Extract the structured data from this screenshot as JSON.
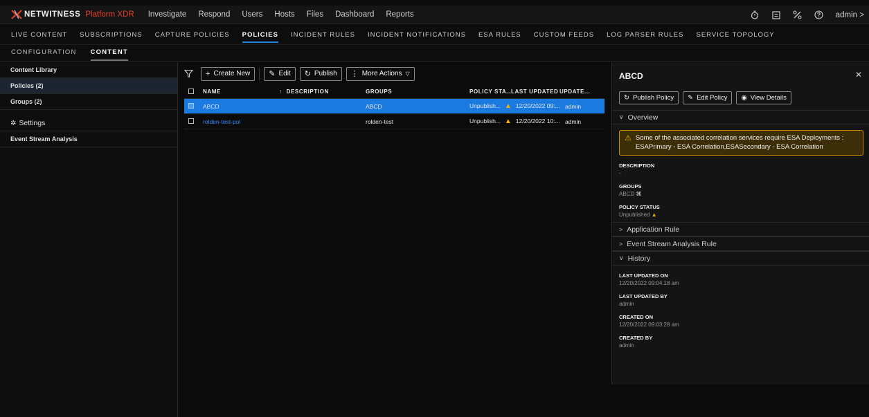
{
  "app": {
    "logo_text": "NETWITNESS",
    "logo_sub": "Platform XDR",
    "nav": [
      "Investigate",
      "Respond",
      "Users",
      "Hosts",
      "Files",
      "Dashboard",
      "Reports"
    ],
    "user": "admin"
  },
  "subnav": [
    "LIVE CONTENT",
    "SUBSCRIPTIONS",
    "CAPTURE POLICIES",
    "POLICIES",
    "INCIDENT RULES",
    "INCIDENT NOTIFICATIONS",
    "ESA RULES",
    "CUSTOM FEEDS",
    "LOG PARSER RULES",
    "SERVICE TOPOLOGY"
  ],
  "subnav_active": "POLICIES",
  "tabs": [
    "CONFIGURATION",
    "CONTENT"
  ],
  "tab_active": "CONTENT",
  "sidebar": {
    "items": [
      "Content Library",
      "Policies (2)",
      "Groups (2)"
    ],
    "selected": "Policies (2)",
    "settings_label": "Settings",
    "settings_items": [
      "Event Stream Analysis"
    ]
  },
  "toolbar": {
    "create_label": "Create New",
    "edit_label": "Edit",
    "publish_label": "Publish",
    "more_label": "More Actions"
  },
  "table": {
    "columns": [
      "NAME",
      "DESCRIPTION",
      "GROUPS",
      "POLICY STA...",
      "LAST UPDATED",
      "UPDATE..."
    ],
    "rows": [
      {
        "name": "ABCD",
        "description": "",
        "groups": "ABCD",
        "status": "Unpublish...",
        "last_updated": "12/20/2022 09:...",
        "updated_by": "admin"
      },
      {
        "name": "rolden-test-pol",
        "description": "",
        "groups": "rolden-test",
        "status": "Unpublish...",
        "last_updated": "12/20/2022 10:...",
        "updated_by": "admin"
      }
    ]
  },
  "panel": {
    "title": "ABCD",
    "actions": [
      "Publish Policy",
      "Edit Policy",
      "View Details"
    ],
    "overview_label": "Overview",
    "alert_line1": "Some of the associated correlation services require ESA Deployments :",
    "alert_line2": "ESAPrimary - ESA Correlation,ESASecondary - ESA Correlation",
    "description_label": "DESCRIPTION",
    "description_value": "-",
    "groups_label": "GROUPS",
    "groups_value": "ABCD",
    "status_label": "POLICY STATUS",
    "status_value": "Unpublished",
    "app_rule_label": "Application Rule",
    "esa_rule_label": "Event Stream Analysis Rule",
    "history_label": "History",
    "history": [
      {
        "label": "LAST UPDATED ON",
        "value": "12/20/2022 09:04:18 am"
      },
      {
        "label": "LAST UPDATED BY",
        "value": "admin"
      },
      {
        "label": "CREATED ON",
        "value": "12/20/2022 09:03:28 am"
      },
      {
        "label": "CREATED BY",
        "value": "admin"
      }
    ]
  },
  "colors": {
    "accent": "#1e83e5",
    "selected_row": "#1b7ae0",
    "brand_red": "#e8402f",
    "warning": "#f6b300"
  }
}
